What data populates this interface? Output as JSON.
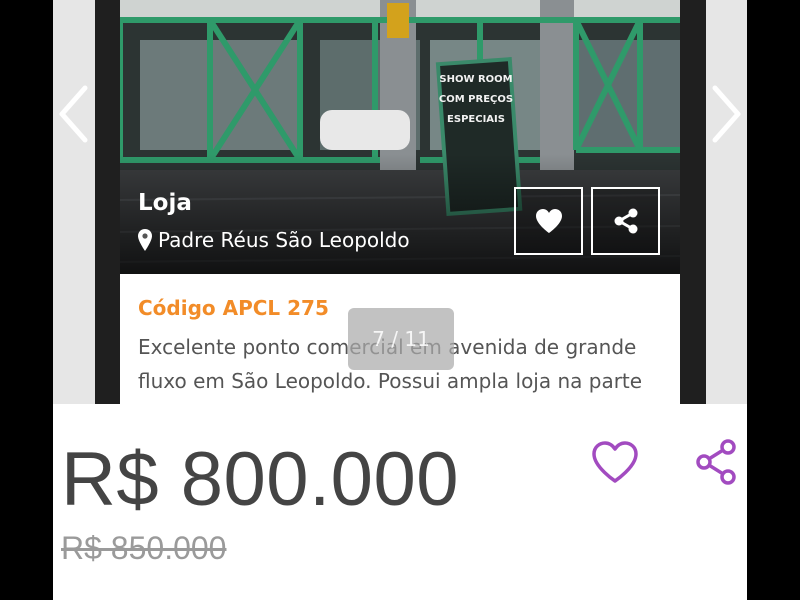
{
  "listing": {
    "type": "Loja",
    "location": "Padre Réus São Leopoldo",
    "code": "Código APCL 275",
    "description": "Excelente ponto comercial em avenida de grande fluxo em São Leopoldo. Possui ampla loja na parte da frente",
    "sign_text": [
      "SHOW ROOM",
      "COM PREÇOS",
      "ESPECIAIS"
    ]
  },
  "gallery": {
    "counter": "7 / 11"
  },
  "pricing": {
    "price": "R$ 800.000",
    "old_price": "R$ 850.000"
  },
  "colors": {
    "code_accent": "#f28c28",
    "action_accent": "#a24bc0",
    "price_text": "#444444",
    "old_price_text": "#9a9a9a"
  },
  "icons": {
    "card_favorite": "heart-icon",
    "card_share": "share-icon",
    "location": "map-pin-icon",
    "prev": "chevron-left-icon",
    "next": "chevron-right-icon",
    "favorite": "heart-outline-icon",
    "share": "share-outline-icon"
  }
}
